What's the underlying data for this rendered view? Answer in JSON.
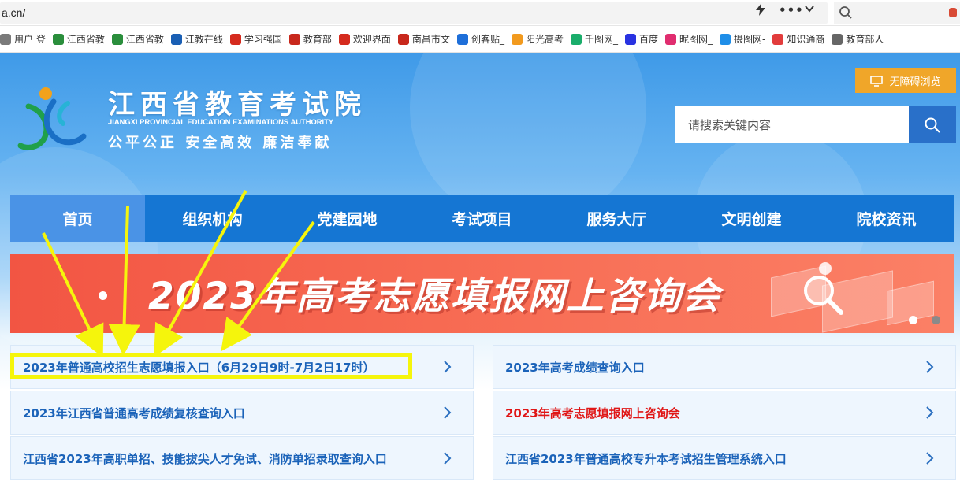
{
  "browser": {
    "url": "a.cn/",
    "bookmarks": [
      {
        "label": "用户 登",
        "icon": "user-icon",
        "color": "#7a7a7a"
      },
      {
        "label": "江西省教",
        "icon": "jx-logo-icon",
        "color": "#2a8e3c"
      },
      {
        "label": "江西省教",
        "icon": "jx-logo-icon",
        "color": "#2a8e3c"
      },
      {
        "label": "江教在线",
        "icon": "jjzx-icon",
        "color": "#1a5fb4"
      },
      {
        "label": "学习强国",
        "icon": "xuexi-icon",
        "color": "#d52b1e"
      },
      {
        "label": "教育部",
        "icon": "moe-icon",
        "color": "#c8281c"
      },
      {
        "label": "欢迎界面",
        "icon": "welcome-icon",
        "color": "#d52b1e"
      },
      {
        "label": "南昌市文",
        "icon": "nc-icon",
        "color": "#c8281c"
      },
      {
        "label": "创客贴_",
        "icon": "chuangke-icon",
        "color": "#1e6fd9"
      },
      {
        "label": "阳光高考",
        "icon": "sunshine-icon",
        "color": "#f29a1e"
      },
      {
        "label": "千图网_",
        "icon": "qiantu-icon",
        "color": "#1aad6b"
      },
      {
        "label": "百度",
        "icon": "baidu-icon",
        "color": "#2932e1"
      },
      {
        "label": "昵图网_",
        "icon": "nipic-icon",
        "color": "#e02d6f"
      },
      {
        "label": "摄图网-",
        "icon": "shetu-icon",
        "color": "#1f8ee8"
      },
      {
        "label": "知识通商",
        "icon": "zhishi-icon",
        "color": "#e23c3c"
      },
      {
        "label": "教育部人",
        "icon": "globe-icon",
        "color": "#666666"
      }
    ]
  },
  "header": {
    "title": "江西省教育考试院",
    "subtitle_en": "JIANGXI PROVINCIAL EDUCATION EXAMINATIONS AUTHORITY",
    "slogan": "公平公正  安全高效  廉洁奉献",
    "a11y_label": "无障碍浏览",
    "search_placeholder": "请搜索关键内容"
  },
  "nav": {
    "items": [
      "首页",
      "组织机构",
      "党建园地",
      "考试项目",
      "服务大厅",
      "文明创建",
      "院校资讯"
    ],
    "active_index": 0
  },
  "banner": {
    "text": "2023年高考志愿填报网上咨询会",
    "slides": 2,
    "active_slide": 0
  },
  "quick_links": {
    "left": [
      {
        "label": "2023年普通高校招生志愿填报入口（6月29日9时-7月2日17时）",
        "highlight": true
      },
      {
        "label": "2023年江西省普通高考成绩复核查询入口"
      },
      {
        "label": "江西省2023年高职单招、技能拔尖人才免试、消防单招录取查询入口"
      }
    ],
    "right": [
      {
        "label": "2023年高考成绩查询入口"
      },
      {
        "label": "2023年高考志愿填报网上咨询会",
        "red": true
      },
      {
        "label": "江西省2023年普通高校专升本考试招生管理系统入口"
      }
    ]
  },
  "colors": {
    "nav_bg": "#1576d3",
    "nav_active": "#4a93e6",
    "accent_orange": "#f0a629",
    "link_blue": "#1b63b9",
    "link_red": "#e01616",
    "annotation_yellow": "#f5f50c"
  }
}
